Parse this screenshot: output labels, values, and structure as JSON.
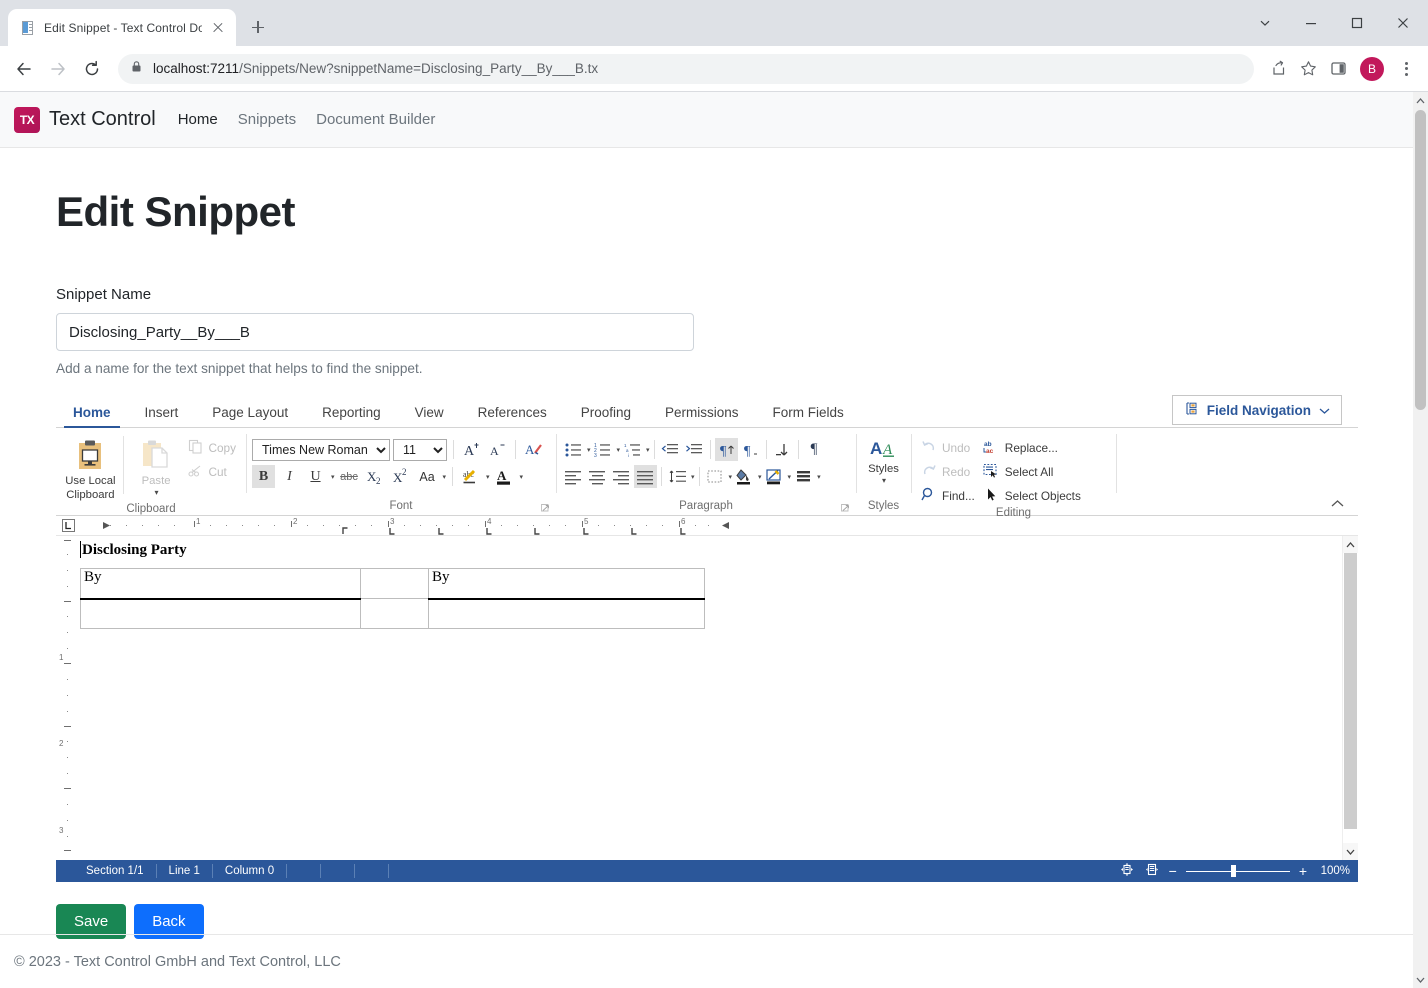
{
  "browser": {
    "tab": {
      "title": "Edit Snippet - Text Control Docur",
      "favicon": "document-icon"
    },
    "new_tab_label": "+",
    "url_host": "localhost:7211",
    "url_path": "/Snippets/New?snippetName=Disclosing_Party__By___B.tx",
    "avatar_initial": "B",
    "window": {
      "minimize": "minimize",
      "maximize": "maximize",
      "close": "close",
      "tabsearch": "tab-search"
    }
  },
  "site": {
    "logo_text": "TX",
    "brand": "Text Control",
    "nav": [
      {
        "label": "Home",
        "active": true
      },
      {
        "label": "Snippets",
        "active": false
      },
      {
        "label": "Document Builder",
        "active": false
      }
    ]
  },
  "page": {
    "title": "Edit Snippet",
    "snippet_name_label": "Snippet Name",
    "snippet_name_value": "Disclosing_Party__By___B",
    "snippet_name_placeholder": "",
    "snippet_help": "Add a name for the text snippet that helps to find the snippet.",
    "save_label": "Save",
    "back_label": "Back",
    "footer": "© 2023 - Text Control GmbH and Text Control, LLC"
  },
  "ribbon": {
    "tabs": [
      {
        "label": "Home",
        "active": true
      },
      {
        "label": "Insert",
        "active": false
      },
      {
        "label": "Page Layout",
        "active": false
      },
      {
        "label": "Reporting",
        "active": false
      },
      {
        "label": "View",
        "active": false
      },
      {
        "label": "References",
        "active": false
      },
      {
        "label": "Proofing",
        "active": false
      },
      {
        "label": "Permissions",
        "active": false
      },
      {
        "label": "Form Fields",
        "active": false
      }
    ],
    "field_navigation_label": "Field Navigation",
    "groups": {
      "clipboard": {
        "title": "Clipboard",
        "use_local_clipboard": "Use Local\nClipboard",
        "use_local_clipboard_l1": "Use Local",
        "use_local_clipboard_l2": "Clipboard",
        "paste": "Paste",
        "copy": "Copy",
        "cut": "Cut"
      },
      "font": {
        "title": "Font",
        "font_name": "Times New Roman",
        "font_size": "11",
        "grow_font": "A",
        "shrink_font": "A",
        "clear_formatting": "clear-formatting",
        "bold": "B",
        "italic": "I",
        "underline": "U",
        "strikethrough": "abc",
        "subscript": "X",
        "superscript": "X",
        "change_case": "Aa",
        "text_highlight": "highlight",
        "font_color": "A"
      },
      "paragraph": {
        "title": "Paragraph",
        "bullets": "bullets",
        "numbering": "numbering",
        "multilevel": "multilevel-list",
        "decrease_indent": "decrease-indent",
        "increase_indent": "increase-indent",
        "ltr": "left-to-right",
        "rtl": "right-to-left",
        "sort": "sort",
        "show_marks": "¶",
        "align_left": "align-left",
        "align_center": "align-center",
        "align_right": "align-right",
        "align_justify": "align-justify",
        "line_spacing": "line-spacing",
        "borders": "borders",
        "shading": "shading",
        "highlight": "highlight",
        "background": "background"
      },
      "styles": {
        "title": "Styles",
        "label": "Styles"
      },
      "editing": {
        "title": "Editing",
        "undo": "Undo",
        "redo": "Redo",
        "find": "Find...",
        "replace": "Replace...",
        "select_all": "Select All",
        "select_objects": "Select Objects"
      }
    }
  },
  "document": {
    "heading": "Disclosing Party",
    "table": {
      "rows": [
        [
          "By",
          "",
          "By"
        ],
        [
          "",
          "",
          ""
        ]
      ]
    },
    "ruler_numbers": [
      "1",
      "2",
      "3",
      "4",
      "5",
      "6"
    ],
    "vruler_numbers": [
      "1",
      "2",
      "3"
    ]
  },
  "status": {
    "section": "Section 1/1",
    "line": "Line 1",
    "column": "Column 0",
    "zoom": "100%",
    "view_icon_1": "page-view-icon",
    "view_icon_2": "layout-view-icon",
    "zoom_out": "−",
    "zoom_in": "+"
  },
  "colors": {
    "accent": "#2b579a",
    "brand": "#c2185b",
    "save": "#198754",
    "back": "#0d6efd"
  }
}
